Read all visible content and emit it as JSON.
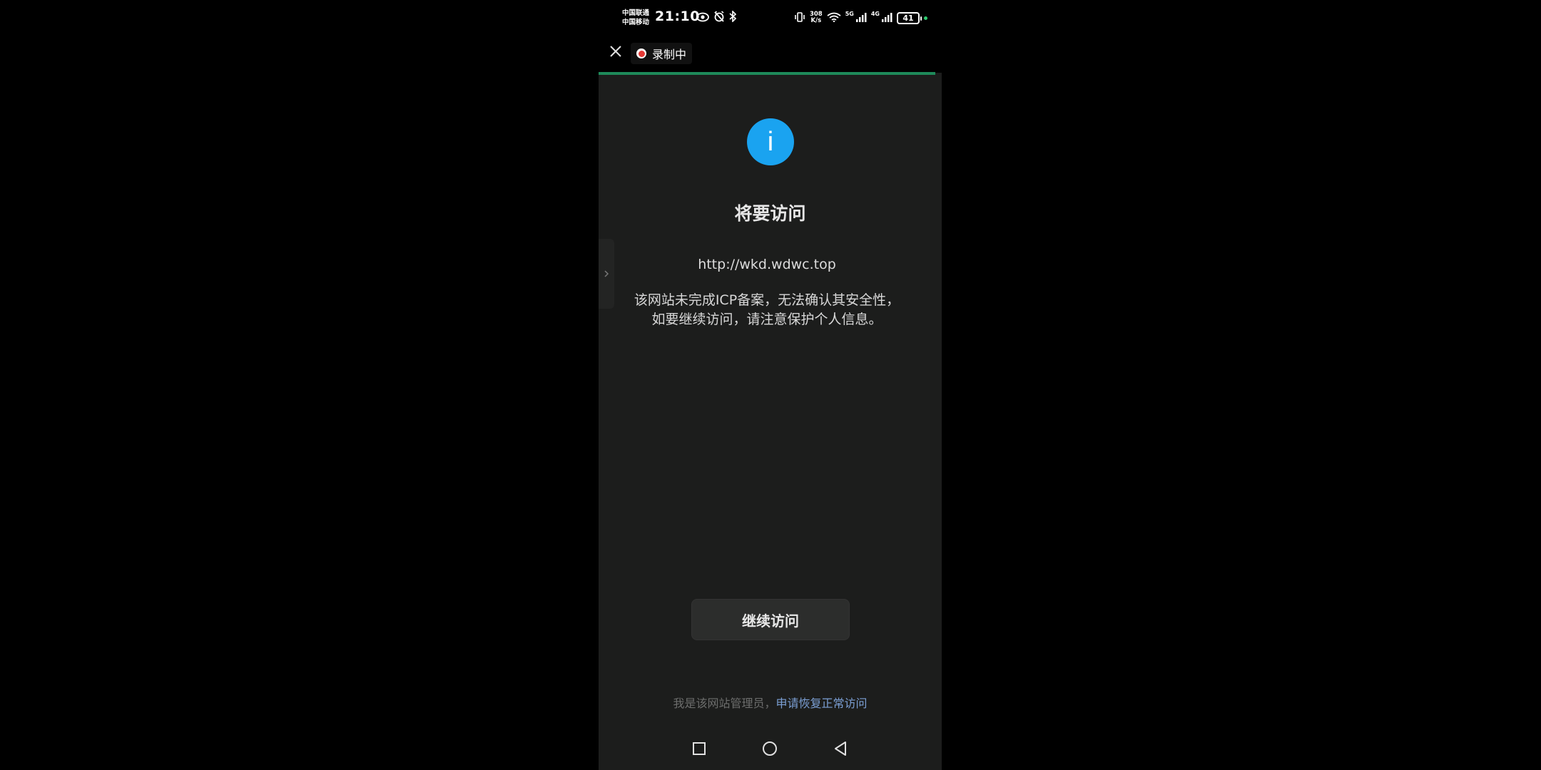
{
  "status_bar": {
    "carrier_1": "中国联通",
    "carrier_2": "中国移动",
    "time": "21:10",
    "net_speed_value": "308",
    "net_speed_unit": "K/s",
    "signal_1_label": "5G",
    "signal_2_label": "4G",
    "battery": "41"
  },
  "topbar": {
    "recording_label": "录制中"
  },
  "page": {
    "title": "将要访问",
    "url": "http://wkd.wdwc.top",
    "warning_line_1": "该网站未完成ICP备案，无法确认其安全性，",
    "warning_line_2": "如要继续访问，请注意保护个人信息。",
    "continue_button": "继续访问",
    "admin_text": "我是该网站管理员，",
    "admin_link": "申请恢复正常访问"
  },
  "icons": {
    "info": "info-icon",
    "close": "close-icon",
    "record": "record-icon",
    "side_chevron": "chevron-right-icon",
    "nav_recent": "square-icon",
    "nav_home": "circle-icon",
    "nav_back": "triangle-back-icon"
  },
  "colors": {
    "info_blue": "#1aa3f0",
    "progress_green": "#1e8a5a",
    "link_blue": "#7b9fd4",
    "record_red": "#e53935"
  }
}
